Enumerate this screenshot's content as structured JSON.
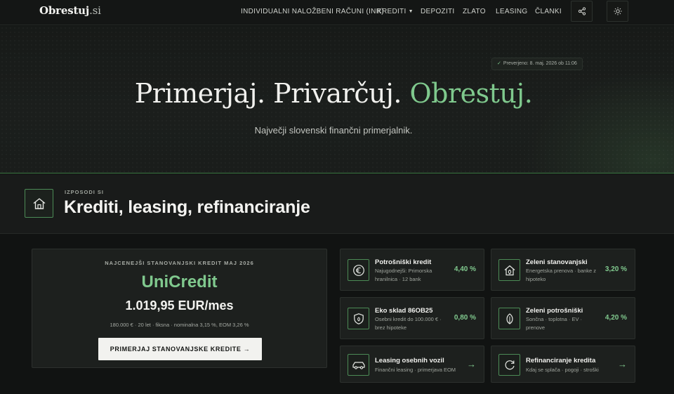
{
  "nav": {
    "logo_main": "Obrestuj",
    "logo_tld": ".si",
    "links": [
      {
        "label": "INDIVIDUALNI NALOŽBENI RAČUNI (INR)"
      },
      {
        "label": "KREDITI"
      },
      {
        "label": "DEPOZITI"
      },
      {
        "label": "ZLATO"
      },
      {
        "label": "LEASING"
      },
      {
        "label": "ČLANKI"
      }
    ],
    "share_icon": "share-icon",
    "theme_icon": "sun-icon"
  },
  "hero": {
    "verified": "Preverjeno: 8. maj. 2026 ob 11:06",
    "title_a": "Primerjaj. Privarčuj. ",
    "title_b": "Obrestuj.",
    "subtitle": "Največji slovenski finančni primerjalnik."
  },
  "section": {
    "eyebrow": "IZPOSODI SI",
    "title": "Krediti, leasing, refinanciranje",
    "icon": "house-icon"
  },
  "featured": {
    "eyebrow": "NAJCENEJŠI STANOVANJSKI KREDIT MAJ 2026",
    "bank": "UniCredit",
    "price": "1.019,95 EUR/mes",
    "details": "180.000 € · 20 let · fiksna · nominalna 3,15 %, EOM 3,26 %",
    "cta": "PRIMERJAJ STANOVANJSKE KREDITE →"
  },
  "cards": [
    {
      "title": "Potrošniški kredit",
      "desc": "Najugodnejši: Primorska hranilnica · 12 bank",
      "rate": "4,40 %",
      "icon": "euro-coin-icon"
    },
    {
      "title": "Zeleni stanovanjski",
      "desc": "Energetska prenova · banke z hipoteko",
      "rate": "3,20 %",
      "icon": "green-house-icon"
    },
    {
      "title": "Eko sklad 86OB25",
      "desc": "Osebni kredit do 100.000 € · brez hipoteke",
      "rate": "0,80 %",
      "icon": "shield-leaf-icon"
    },
    {
      "title": "Zeleni potrošniški",
      "desc": "Sončna · toplotna · EV · prenove",
      "rate": "4,20 %",
      "icon": "leaf-icon"
    },
    {
      "title": "Leasing osebnih vozil",
      "desc": "Finančni leasing · primerjava EOM",
      "rate": "→",
      "icon": "car-icon"
    },
    {
      "title": "Refinanciranje kredita",
      "desc": "Kdaj se splača · pogoji · stroški",
      "rate": "→",
      "icon": "refresh-icon"
    }
  ],
  "colors": {
    "accent": "#80c98e",
    "background": "#111312",
    "card": "#1d201e"
  }
}
